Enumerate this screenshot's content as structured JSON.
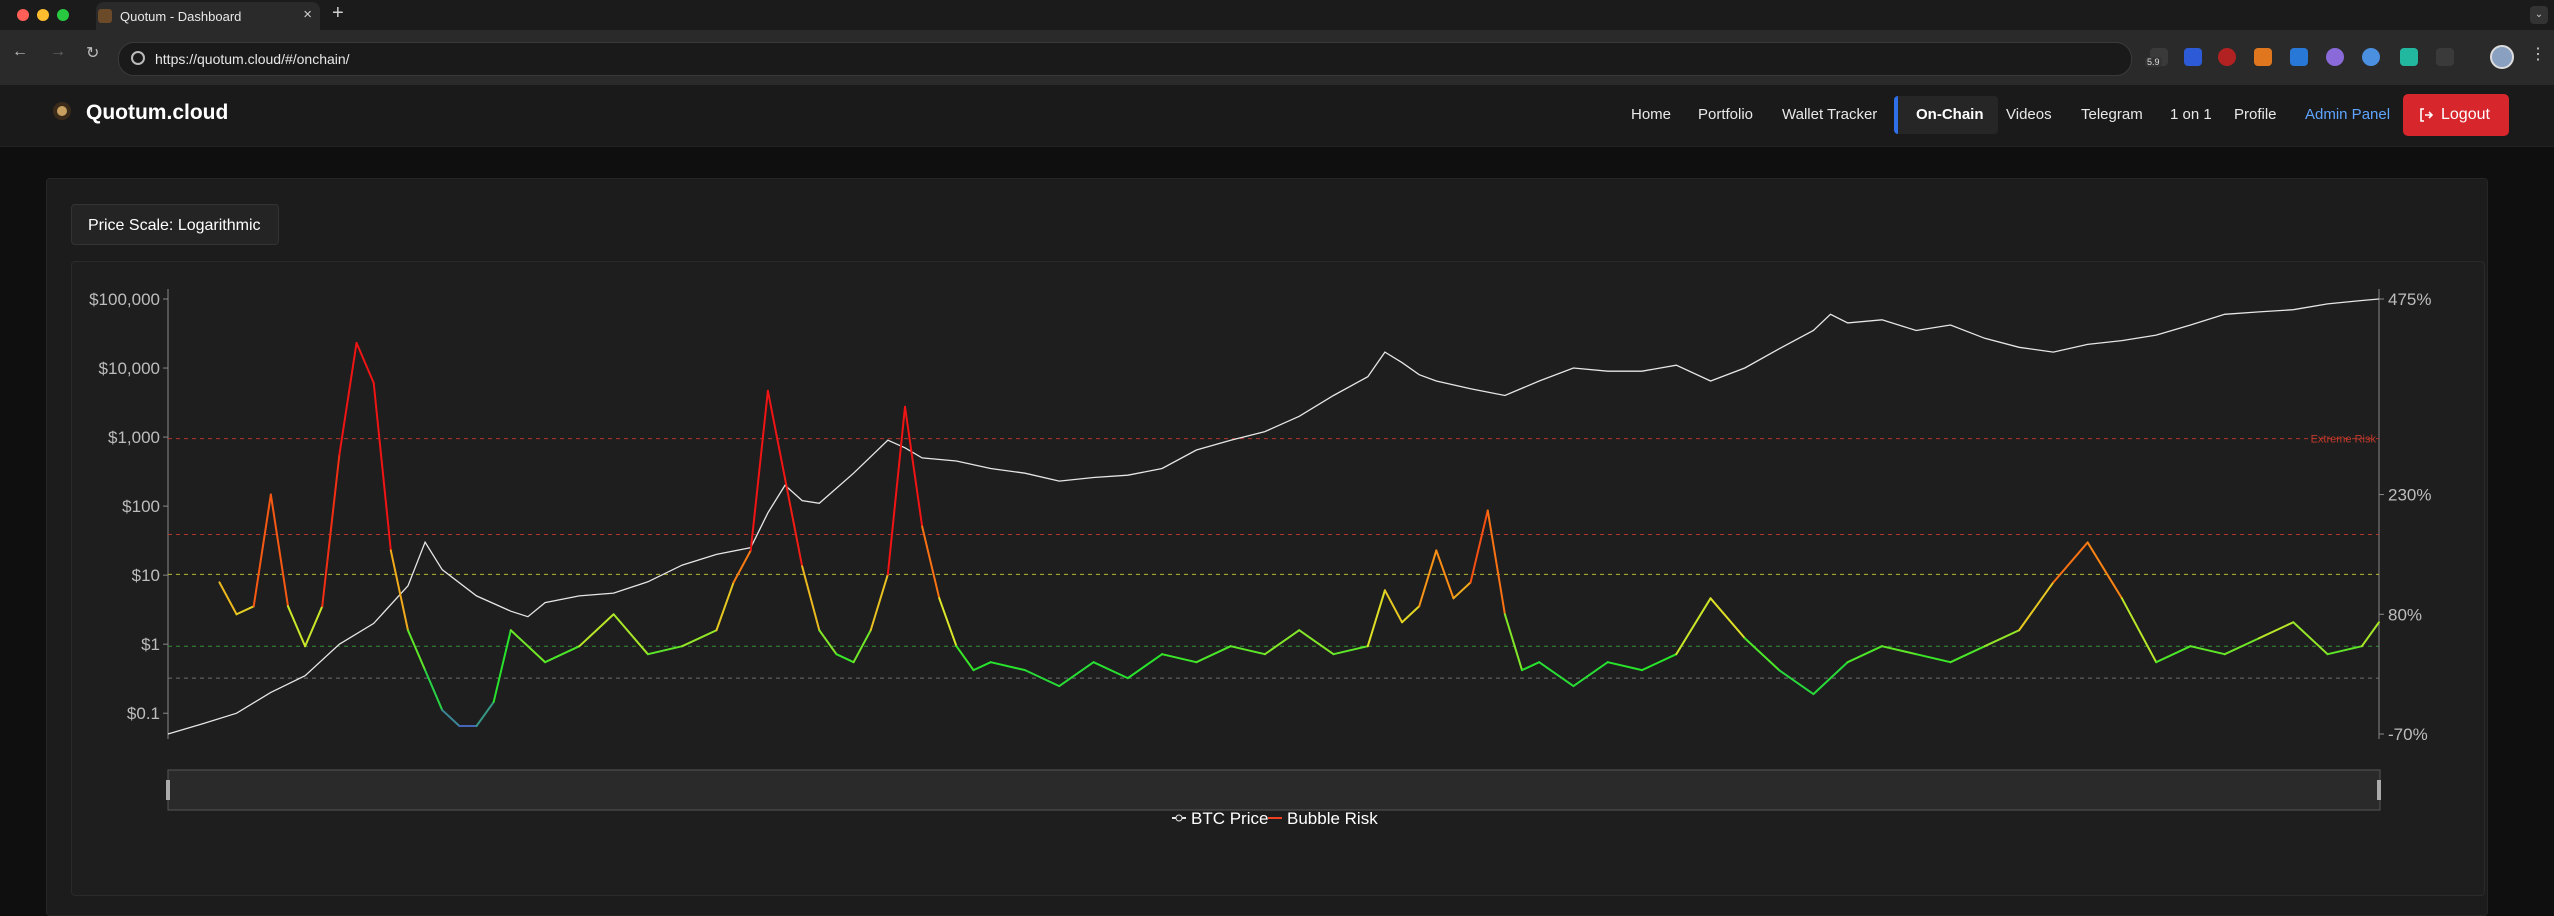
{
  "browser": {
    "tab_title": "Quotum - Dashboard",
    "url": "https://quotum.cloud/#/onchain/",
    "extension_badge": "5.9"
  },
  "header": {
    "brand": "Quotum.cloud",
    "nav": [
      {
        "label": "Home",
        "active": false
      },
      {
        "label": "Portfolio",
        "active": false
      },
      {
        "label": "Wallet Tracker",
        "active": false
      },
      {
        "label": "On-Chain",
        "active": true
      },
      {
        "label": "Videos",
        "active": false
      },
      {
        "label": "Telegram",
        "active": false
      },
      {
        "label": "1 on 1",
        "active": false
      },
      {
        "label": "Profile",
        "active": false
      },
      {
        "label": "Admin Panel",
        "active": false
      }
    ],
    "logout_label": "Logout",
    "colors": {
      "accent": "#2f6fe8",
      "logout": "#d8262d",
      "admin": "#5fa4ff"
    }
  },
  "controls": {
    "price_scale_label": "Price Scale: Logarithmic"
  },
  "chart_data": {
    "type": "line",
    "y_left": {
      "scale": "log",
      "ticks": [
        "$100,000",
        "$10,000",
        "$1,000",
        "$100",
        "$10",
        "$1",
        "$0.1"
      ],
      "range": [
        0.05,
        100000
      ]
    },
    "y_right": {
      "ticks": [
        "475%",
        "230%",
        "80%",
        "-70%"
      ],
      "range": [
        -70,
        475
      ]
    },
    "thresholds": [
      {
        "label": "Extreme Risk",
        "value": 300,
        "color": "#c0392b"
      },
      {
        "label": "",
        "value": 180,
        "color": "#c0392b"
      },
      {
        "label": "",
        "value": 130,
        "color": "#c8c832"
      },
      {
        "label": "",
        "value": 40,
        "color": "#3a9a3a"
      },
      {
        "label": "",
        "value": 0,
        "color": "#777777"
      }
    ],
    "series": [
      {
        "name": "BTC Price",
        "color": "#e6e6e6",
        "axis": "left",
        "points": [
          [
            0,
            0.05
          ],
          [
            2,
            0.07
          ],
          [
            4,
            0.1
          ],
          [
            6,
            0.2
          ],
          [
            8,
            0.35
          ],
          [
            10,
            1.0
          ],
          [
            12,
            2.0
          ],
          [
            14,
            7.0
          ],
          [
            15,
            30.0
          ],
          [
            16,
            12.0
          ],
          [
            18,
            5.0
          ],
          [
            20,
            3.0
          ],
          [
            21,
            2.5
          ],
          [
            22,
            4.0
          ],
          [
            24,
            5.0
          ],
          [
            26,
            5.5
          ],
          [
            28,
            8.0
          ],
          [
            30,
            14.0
          ],
          [
            32,
            20.0
          ],
          [
            34,
            25.0
          ],
          [
            35,
            80.0
          ],
          [
            36,
            200.0
          ],
          [
            37,
            120.0
          ],
          [
            38,
            110.0
          ],
          [
            40,
            300.0
          ],
          [
            42,
            900.0
          ],
          [
            43,
            700.0
          ],
          [
            44,
            500.0
          ],
          [
            46,
            450.0
          ],
          [
            48,
            350.0
          ],
          [
            50,
            300.0
          ],
          [
            52,
            230.0
          ],
          [
            54,
            260.0
          ],
          [
            56,
            280.0
          ],
          [
            58,
            350.0
          ],
          [
            60,
            650.0
          ],
          [
            62,
            900.0
          ],
          [
            64,
            1200.0
          ],
          [
            66,
            2000.0
          ],
          [
            68,
            4000.0
          ],
          [
            70,
            7500.0
          ],
          [
            71,
            17000.0
          ],
          [
            72,
            12000.0
          ],
          [
            73,
            8000.0
          ],
          [
            74,
            6500.0
          ],
          [
            76,
            5000.0
          ],
          [
            78,
            4000.0
          ],
          [
            80,
            6500.0
          ],
          [
            82,
            10000.0
          ],
          [
            84,
            9000.0
          ],
          [
            86,
            9000.0
          ],
          [
            88,
            11000.0
          ],
          [
            90,
            6500.0
          ],
          [
            92,
            10000.0
          ],
          [
            94,
            19000.0
          ],
          [
            96,
            35000.0
          ],
          [
            97,
            60000.0
          ],
          [
            98,
            45000.0
          ],
          [
            100,
            50000.0
          ],
          [
            102,
            35000.0
          ],
          [
            104,
            42000.0
          ],
          [
            106,
            27000.0
          ],
          [
            108,
            20000.0
          ],
          [
            110,
            17000.0
          ],
          [
            112,
            22000.0
          ],
          [
            114,
            25000.0
          ],
          [
            116,
            30000.0
          ],
          [
            118,
            42000.0
          ],
          [
            120,
            60000.0
          ],
          [
            122,
            65000.0
          ],
          [
            124,
            70000.0
          ],
          [
            126,
            85000.0
          ],
          [
            128,
            95000.0
          ],
          [
            129,
            100000.0
          ]
        ]
      },
      {
        "name": "Bubble Risk",
        "color": "gradient",
        "axis": "right",
        "points": [
          [
            3,
            120
          ],
          [
            4,
            80
          ],
          [
            5,
            90
          ],
          [
            6,
            230
          ],
          [
            7,
            90
          ],
          [
            8,
            40
          ],
          [
            9,
            90
          ],
          [
            10,
            280
          ],
          [
            11,
            420
          ],
          [
            12,
            370
          ],
          [
            13,
            160
          ],
          [
            14,
            60
          ],
          [
            15,
            10
          ],
          [
            16,
            -40
          ],
          [
            17,
            -60
          ],
          [
            18,
            -60
          ],
          [
            19,
            -30
          ],
          [
            20,
            60
          ],
          [
            22,
            20
          ],
          [
            24,
            40
          ],
          [
            26,
            80
          ],
          [
            28,
            30
          ],
          [
            30,
            40
          ],
          [
            32,
            60
          ],
          [
            33,
            120
          ],
          [
            34,
            160
          ],
          [
            35,
            360
          ],
          [
            36,
            250
          ],
          [
            37,
            140
          ],
          [
            38,
            60
          ],
          [
            39,
            30
          ],
          [
            40,
            20
          ],
          [
            41,
            60
          ],
          [
            42,
            130
          ],
          [
            43,
            340
          ],
          [
            44,
            190
          ],
          [
            45,
            100
          ],
          [
            46,
            40
          ],
          [
            47,
            10
          ],
          [
            48,
            20
          ],
          [
            50,
            10
          ],
          [
            52,
            -10
          ],
          [
            54,
            20
          ],
          [
            56,
            0
          ],
          [
            58,
            30
          ],
          [
            60,
            20
          ],
          [
            62,
            40
          ],
          [
            64,
            30
          ],
          [
            66,
            60
          ],
          [
            68,
            30
          ],
          [
            70,
            40
          ],
          [
            71,
            110
          ],
          [
            72,
            70
          ],
          [
            73,
            90
          ],
          [
            74,
            160
          ],
          [
            75,
            100
          ],
          [
            76,
            120
          ],
          [
            77,
            210
          ],
          [
            78,
            80
          ],
          [
            79,
            10
          ],
          [
            80,
            20
          ],
          [
            82,
            -10
          ],
          [
            84,
            20
          ],
          [
            86,
            10
          ],
          [
            88,
            30
          ],
          [
            90,
            100
          ],
          [
            92,
            50
          ],
          [
            94,
            10
          ],
          [
            96,
            -20
          ],
          [
            98,
            20
          ],
          [
            100,
            40
          ],
          [
            102,
            30
          ],
          [
            104,
            20
          ],
          [
            106,
            40
          ],
          [
            108,
            60
          ],
          [
            110,
            120
          ],
          [
            112,
            170
          ],
          [
            114,
            100
          ],
          [
            116,
            20
          ],
          [
            118,
            40
          ],
          [
            120,
            30
          ],
          [
            122,
            50
          ],
          [
            124,
            70
          ],
          [
            126,
            30
          ],
          [
            128,
            40
          ],
          [
            129,
            70
          ]
        ]
      }
    ],
    "legend": [
      "BTC Price",
      "Bubble Risk"
    ],
    "legend_position": "bottom-center"
  }
}
